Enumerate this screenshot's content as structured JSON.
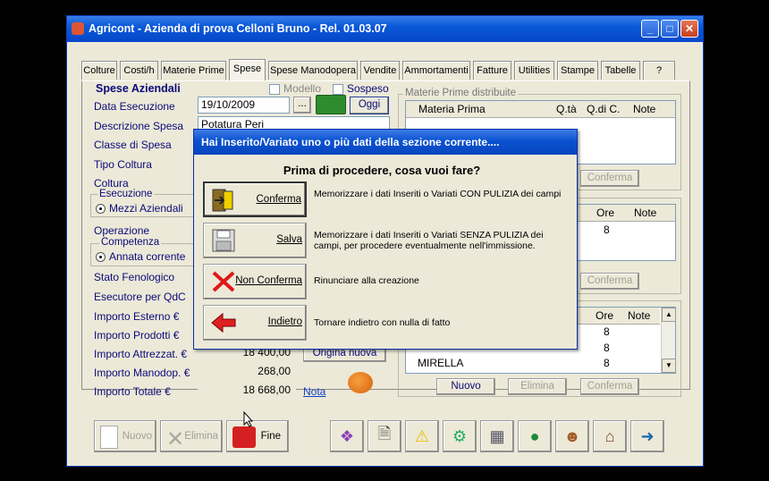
{
  "window": {
    "title": "Agricont - Azienda di prova Celloni Bruno - Rel. 01.03.07",
    "min_icon": "minimize-icon",
    "max_icon": "maximize-icon",
    "close_icon": "close-icon"
  },
  "tabs": [
    {
      "label": "Colture"
    },
    {
      "label": "Costi/h"
    },
    {
      "label": "Materie Prime"
    },
    {
      "label": "Spese"
    },
    {
      "label": "Spese Manodopera"
    },
    {
      "label": "Vendite"
    },
    {
      "label": "Ammortamenti"
    },
    {
      "label": "Fatture"
    },
    {
      "label": "Utilities"
    },
    {
      "label": "Stampe"
    },
    {
      "label": "Tabelle"
    },
    {
      "label": "?"
    }
  ],
  "form": {
    "group_title": "Spese Aziendali",
    "modello_label": "Modello",
    "sospeso_label": "Sospeso",
    "data_esecuzione_label": "Data Esecuzione",
    "data_esecuzione_value": "19/10/2009",
    "dots_label": "...",
    "oggi_label": "Oggi",
    "descrizione_label": "Descrizione Spesa",
    "descrizione_value": "Potatura Peri",
    "classe_label": "Classe di Spesa",
    "tipo_coltura_label": "Tipo Coltura",
    "coltura_label": "Coltura",
    "esecuzione_group": "Esecuzione",
    "mezzi_aziendali_label": "Mezzi Aziendali",
    "operazione_label": "Operazione",
    "competenza_group": "Competenza",
    "annata_corrente_label": "Annata corrente",
    "stato_fenologico_label": "Stato Fenologico",
    "esecutore_label": "Esecutore per QdC",
    "importo_esterno_label": "Importo Esterno €",
    "importo_prodotti_label": "Importo Prodotti €",
    "importo_attrezzat_label": "Importo Attrezzat. €",
    "importo_attrezzat_value": "18 400,00",
    "origina_nuova_label": "Origina nuova",
    "importo_manodop_label": "Importo Manodop. €",
    "importo_manodop_value": "268,00",
    "importo_totale_label": "Importo Totale €",
    "importo_totale_value": "18 668,00",
    "nota_label": "Nota"
  },
  "materie_prime": {
    "group_title": "Materie Prime distribuite",
    "columns": [
      "Materia Prima",
      "Q.tà",
      "Q.di C.",
      "Note"
    ],
    "conferma_label": "Conferma"
  },
  "grid2": {
    "columns": [
      "Ore",
      "Note"
    ],
    "rows": [
      {
        "ore": "8"
      }
    ],
    "conferma_label": "Conferma"
  },
  "grid3": {
    "columns": [
      "Ore",
      "Note"
    ],
    "rows": [
      {
        "name": "",
        "ore": "8"
      },
      {
        "name": "",
        "ore": "8"
      },
      {
        "name": "MIRELLA",
        "ore": "8"
      }
    ],
    "nuovo_label": "Nuovo",
    "elimina_label": "Elimina",
    "conferma_label": "Conferma"
  },
  "toolbar": {
    "nuovo_label": "Nuovo",
    "elimina_label": "Elimina",
    "fine_label": "Fine",
    "icons": [
      "help-book-icon",
      "document-search-icon",
      "warning-icon",
      "people-icon",
      "calculator-icon",
      "globe-icon",
      "users-icon",
      "shop-icon",
      "exit-door-icon"
    ]
  },
  "dialog": {
    "title": "Hai Inserito/Variato uno o più dati della sezione corrente....",
    "question": "Prima di procedere, cosa vuoi fare?",
    "options": [
      {
        "label": "Conferma",
        "desc": "Memorizzare i dati Inseriti o Variati CON PULIZIA dei campi"
      },
      {
        "label": "Salva",
        "desc": "Memorizzare i dati Inseriti o Variati SENZA PULIZIA dei campi, per procedere eventualmente nell'immissione."
      },
      {
        "label": "Non Conferma",
        "desc": "Rinunciare alla creazione"
      },
      {
        "label": "Indietro",
        "desc": "Tornare indietro con nulla di fatto"
      }
    ]
  }
}
